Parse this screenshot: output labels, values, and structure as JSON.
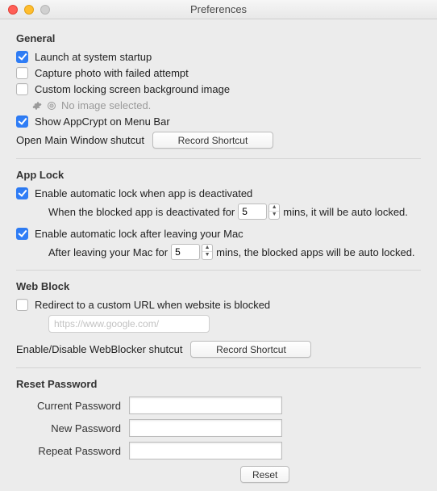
{
  "window": {
    "title": "Preferences"
  },
  "general": {
    "heading": "General",
    "launch_label": "Launch at system startup",
    "launch_checked": true,
    "capture_label": "Capture photo with failed attempt",
    "capture_checked": false,
    "custom_bg_label": "Custom locking screen background image",
    "custom_bg_checked": false,
    "no_image_text": "No image selected.",
    "menubar_label": "Show AppCrypt on Menu Bar",
    "menubar_checked": true,
    "open_main_label": "Open Main Window shutcut",
    "record_shortcut_label": "Record Shortcut"
  },
  "applock": {
    "heading": "App Lock",
    "deact_label": "Enable automatic lock when app is deactivated",
    "deact_checked": true,
    "deact_line_a": "When the blocked app is deactivated for",
    "deact_value": "5",
    "deact_line_b": "mins, it will be auto locked.",
    "leave_label": "Enable automatic lock after leaving your Mac",
    "leave_checked": true,
    "leave_line_a": "After leaving your Mac for",
    "leave_value": "5",
    "leave_line_b": "mins, the blocked apps will be auto locked."
  },
  "webblock": {
    "heading": "Web Block",
    "redirect_label": "Redirect to a custom URL when website is blocked",
    "redirect_checked": false,
    "url_placeholder": "https://www.google.com/",
    "shortcut_label": "Enable/Disable WebBlocker shutcut",
    "record_shortcut_label": "Record Shortcut"
  },
  "reset": {
    "heading": "Reset Password",
    "current_label": "Current Password",
    "new_label": "New Password",
    "repeat_label": "Repeat Password",
    "reset_button": "Reset"
  }
}
